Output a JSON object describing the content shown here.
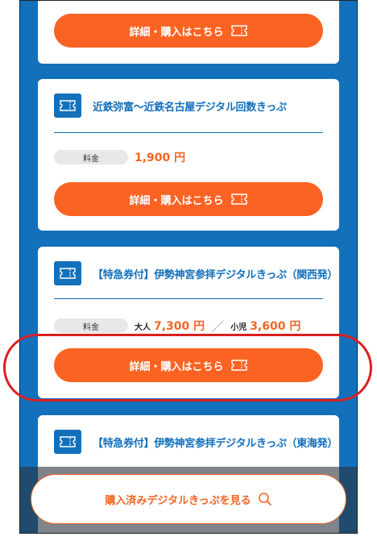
{
  "cta_label": "詳細・購入はこちら",
  "price_label": "料金",
  "cards": [
    {
      "title": "近鉄弥富〜近鉄名古屋デジタル回数きっぷ",
      "price": "1,900 円"
    },
    {
      "title": "【特急券付】伊勢神宮参拝デジタルきっぷ（関西発）",
      "adult_label": "大人",
      "adult_price": "7,300 円",
      "sep": "／",
      "child_label": "小児",
      "child_price": "3,600 円"
    },
    {
      "title": "【特急券付】伊勢神宮参拝デジタルきっぷ（東海発）"
    }
  ],
  "floating_button": {
    "label": "購入済みデジタルきっぷを見る"
  },
  "icons": {
    "ticket": "ticket-icon",
    "search": "search-icon"
  },
  "colors": {
    "accent": "#fb6323",
    "brand_blue": "#1370bb",
    "highlight": "#d9201f"
  }
}
